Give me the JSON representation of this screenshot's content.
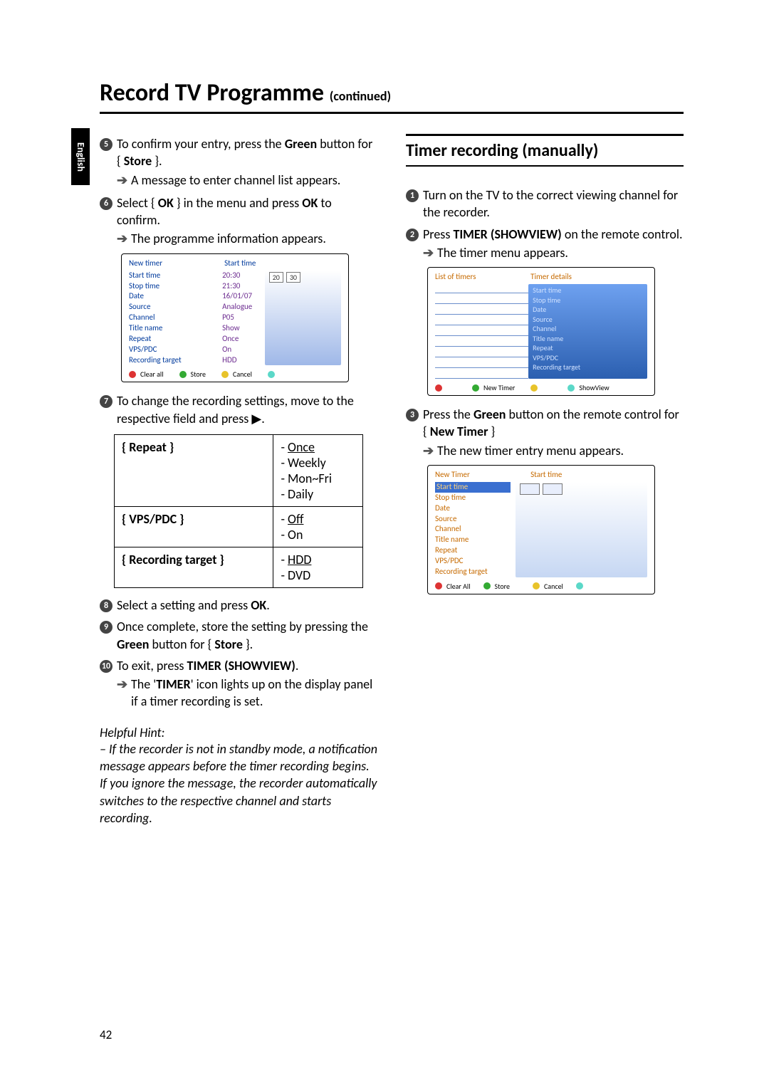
{
  "lang_tab": "English",
  "title_main": "Record TV Programme",
  "title_cont": "(continued)",
  "page_number": "42",
  "left": {
    "step5_a": "To confirm your entry, press the ",
    "step5_b_bold": "Green",
    "step5_c": " button for { ",
    "step5_d_bold": "Store",
    "step5_e": " }.",
    "step5_sub": "A message to enter channel list appears.",
    "step6_a": "Select { ",
    "step6_b_bold": "OK",
    "step6_c": " } in the menu and press ",
    "step6_d_bold": "OK",
    "step6_e": " to confirm.",
    "step6_sub": "The programme information appears.",
    "panel1": {
      "hdr_left": "New timer",
      "hdr_right": "Start time",
      "labels": [
        "Start time",
        "Stop time",
        "Date",
        "Source",
        "Channel",
        "Title name",
        "Repeat",
        "VPS/PDC",
        "Recording target"
      ],
      "vals": [
        "20:30",
        "21:30",
        "16/01/07",
        "Analogue",
        "P05",
        "Show",
        "Once",
        "On",
        "HDD"
      ],
      "time_a": "20",
      "time_b": "30",
      "foot": {
        "red": "Clear all",
        "green": "Store",
        "yellow": "Cancel"
      }
    },
    "step7": "To change the recording settings, move to the respective field and press ▶.",
    "table": {
      "r1_label": "{ Repeat }",
      "r1_opts": [
        "Once",
        "Weekly",
        "Mon~Fri",
        "Daily"
      ],
      "r2_label": "{ VPS/PDC }",
      "r2_opts": [
        "Off",
        "On"
      ],
      "r3_label": "{ Recording target }",
      "r3_opts": [
        "HDD",
        "DVD"
      ]
    },
    "step8_a": "Select a setting and press ",
    "step8_b_bold": "OK",
    "step8_c": ".",
    "step9_a": "Once complete, store the setting by pressing the ",
    "step9_b_bold": "Green",
    "step9_c": " button for { ",
    "step9_d_bold": "Store",
    "step9_e": " }.",
    "step10_a": "To exit, press ",
    "step10_b_bold": "TIMER (SHOWVIEW)",
    "step10_c": ".",
    "step10_sub_a": "The '",
    "step10_sub_b_sc": "TIMER",
    "step10_sub_c": "' icon lights up on the display panel if a timer recording is set.",
    "hint_title": "Helpful Hint:",
    "hint_body": "– If the recorder is not in standby mode, a notification message appears before the timer recording begins.  If you ignore the message, the recorder automatically switches to the respective channel and starts recording."
  },
  "right": {
    "section_title": "Timer recording (manually)",
    "step1": "Turn on the TV to the correct viewing channel for the recorder.",
    "step2_a": "Press ",
    "step2_b_bold": "TIMER (SHOWVIEW)",
    "step2_c": " on the remote control.",
    "step2_sub": "The timer menu appears.",
    "panel2": {
      "hdr_left": "List of timers",
      "hdr_right": "Timer details",
      "detail_labels": [
        "Start time",
        "Stop time",
        "Date",
        "Source",
        "Channel",
        "Title name",
        "Repeat",
        "VPS/PDC",
        "Recording target"
      ],
      "foot": {
        "green": "New Timer",
        "cyan": "ShowView"
      }
    },
    "step3_a": "Press the ",
    "step3_b_bold": "Green",
    "step3_c": " button on the remote control for { ",
    "step3_d_bold": "New Timer",
    "step3_e": " }",
    "step3_sub": "The new timer entry menu appears.",
    "panel3": {
      "hdr_left": "New Timer",
      "hdr_right": "Start time",
      "labels": [
        "Start time",
        "Stop time",
        "Date",
        "Source",
        "Channel",
        "Title name",
        "Repeat",
        "VPS/PDC",
        "Recording target"
      ],
      "foot": {
        "red": "Clear All",
        "green": "Store",
        "yellow": "Cancel"
      }
    }
  },
  "nums": {
    "n1": "1",
    "n2": "2",
    "n3": "3",
    "n5": "5",
    "n6": "6",
    "n7": "7",
    "n8": "8",
    "n9": "9",
    "n10": "10"
  }
}
